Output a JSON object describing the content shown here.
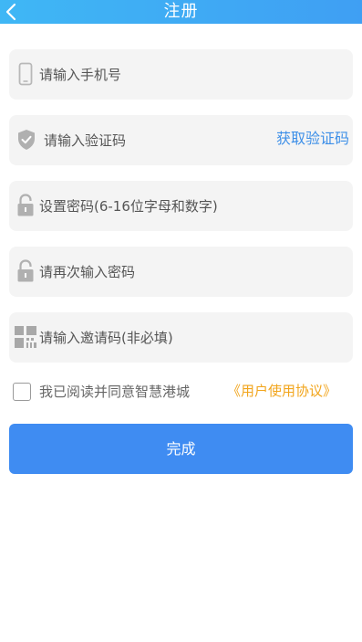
{
  "header": {
    "title": "注册",
    "back_icon": "chevron-left-icon"
  },
  "form": {
    "phone": {
      "placeholder": "请输入手机号",
      "value": "",
      "icon": "phone-icon"
    },
    "verify_code": {
      "placeholder": "请输入验证码",
      "value": "",
      "icon": "shield-check-icon",
      "button_label": "获取验证码"
    },
    "password": {
      "placeholder": "设置密码(6-16位字母和数字)",
      "value": "",
      "icon": "lock-icon"
    },
    "password_confirm": {
      "placeholder": "请再次输入密码",
      "value": "",
      "icon": "lock-icon"
    },
    "invite_code": {
      "placeholder": "请输入邀请码(非必填)",
      "value": "",
      "icon": "qr-code-icon"
    }
  },
  "agreement": {
    "checked": false,
    "text": "我已阅读并同意智慧港城",
    "link": "《用户使用协议》"
  },
  "submit_label": "完成",
  "colors": {
    "header_start": "#3fb7f5",
    "header_end": "#3f9ff3",
    "field_bg": "#f4f4f4",
    "accent_blue": "#3f8cf2",
    "link_blue": "#3d8fe8",
    "link_orange": "#f2a51c",
    "icon_gray": "#b8b8b8"
  }
}
